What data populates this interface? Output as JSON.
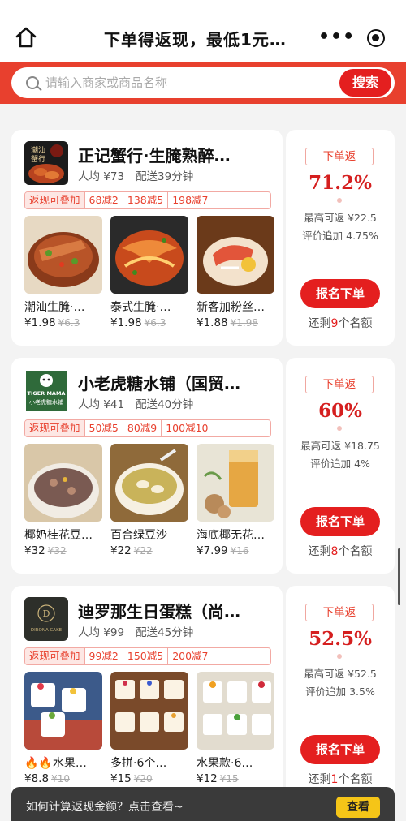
{
  "header": {
    "title": "下单得返现，最低1元…",
    "more_glyph": "•••"
  },
  "search": {
    "placeholder": "请输入商家或商品名称",
    "button_label": "搜索"
  },
  "cards": [
    {
      "shop_name": "正记蟹行·生腌熟醉…",
      "per_capita": "人均 ¥73",
      "delivery": "配送39分钟",
      "tags": [
        "返现可叠加",
        "68减2",
        "138减5",
        "198减7"
      ],
      "items": [
        {
          "name": "潮汕生腌·…",
          "price": "¥1.98",
          "orig": "¥6.3"
        },
        {
          "name": "泰式生腌·…",
          "price": "¥1.98",
          "orig": "¥6.3"
        },
        {
          "name": "新客加粉丝…",
          "price": "¥1.88",
          "orig": "¥1.98"
        }
      ],
      "badge": "下单返",
      "rate": "71.2%",
      "max_return": "最高可返 ¥22.5",
      "review_bonus": "评价追加 4.75%",
      "button": "报名下单",
      "remain_prefix": "还剩",
      "remain_count": "9",
      "remain_suffix": "个名额"
    },
    {
      "shop_name": "小老虎糖水铺（国贸…",
      "per_capita": "人均 ¥41",
      "delivery": "配送40分钟",
      "tags": [
        "返现可叠加",
        "50减5",
        "80减9",
        "100减10"
      ],
      "items": [
        {
          "name": "椰奶桂花豆…",
          "price": "¥32",
          "orig": "¥32"
        },
        {
          "name": "百合绿豆沙",
          "price": "¥22",
          "orig": "¥22"
        },
        {
          "name": "海底椰无花…",
          "price": "¥7.99",
          "orig": "¥16"
        }
      ],
      "badge": "下单返",
      "rate": "60%",
      "max_return": "最高可返 ¥18.75",
      "review_bonus": "评价追加 4%",
      "button": "报名下单",
      "remain_prefix": "还剩",
      "remain_count": "8",
      "remain_suffix": "个名额"
    },
    {
      "shop_name": "迪罗那生日蛋糕（尚…",
      "per_capita": "人均 ¥99",
      "delivery": "配送45分钟",
      "tags": [
        "返现可叠加",
        "99减2",
        "150减5",
        "200减7"
      ],
      "items": [
        {
          "name": "🔥🔥水果…",
          "price": "¥8.8",
          "orig": "¥10"
        },
        {
          "name": "多拼·6个…",
          "price": "¥15",
          "orig": "¥20"
        },
        {
          "name": "水果款·6…",
          "price": "¥12",
          "orig": "¥15"
        }
      ],
      "badge": "下单返",
      "rate": "52.5%",
      "max_return": "最高可返 ¥52.5",
      "review_bonus": "评价追加 3.5%",
      "button": "报名下单",
      "remain_prefix": "还剩",
      "remain_count": "1",
      "remain_suffix": "个名额"
    }
  ],
  "logos": [
    {
      "line1": "潮汕",
      "line2": "蟹行"
    },
    {
      "line1": "TIGER MAMA",
      "line2": "小老虎糖水铺"
    },
    {
      "line1": "D",
      "line2": "DIRONA CAKE"
    }
  ],
  "bottom": {
    "text": "如何计算返现金额？点击查看~",
    "button": "查看"
  },
  "colors": {
    "accent": "#e8402e",
    "button_red": "#e41f1f",
    "rate_red": "#d51f1f",
    "yellow": "#f5c518"
  }
}
